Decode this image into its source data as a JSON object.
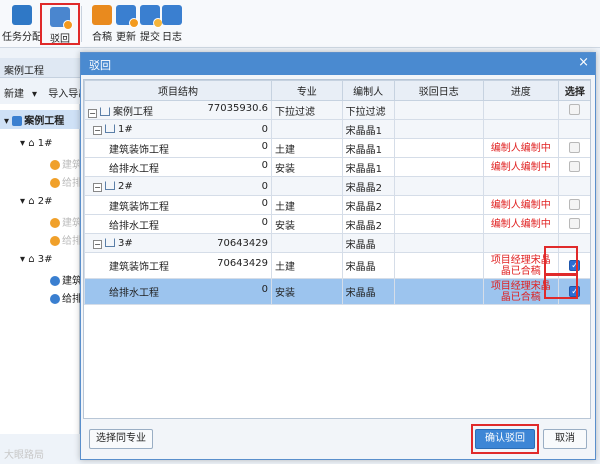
{
  "toolbar": {
    "buttons": [
      {
        "label": "任务分配",
        "icon": "assign-icon"
      },
      {
        "label": "驳回",
        "icon": "reject-icon"
      },
      {
        "label": "合稿",
        "icon": "merge-icon"
      },
      {
        "label": "更新",
        "icon": "update-icon"
      },
      {
        "label": "提交",
        "icon": "submit-icon"
      },
      {
        "label": "日志",
        "icon": "log-icon"
      }
    ]
  },
  "left": {
    "header": "案例工程",
    "tool_new": "新建",
    "tool_io": "导入导出",
    "tree": [
      {
        "label": "案例工程"
      },
      {
        "label": "1#"
      },
      {
        "label": "建筑"
      },
      {
        "label": "给排"
      },
      {
        "label": "2#"
      },
      {
        "label": "建筑"
      },
      {
        "label": "给排"
      },
      {
        "label": "3#"
      },
      {
        "label": "建筑"
      },
      {
        "label": "给排"
      }
    ]
  },
  "dialog": {
    "title": "驳回",
    "columns": [
      "项目结构",
      "专业",
      "编制人",
      "驳回日志",
      "进度",
      "选择"
    ],
    "rows": [
      {
        "name": "案例工程",
        "amount": "77035930.6",
        "major": "下拉过滤",
        "editor": "下拉过滤",
        "log": "",
        "progress": "",
        "level": 0
      },
      {
        "name": "1#",
        "amount": "0",
        "major": "",
        "editor": "宋晶晶1",
        "log": "",
        "progress": "",
        "level": 1
      },
      {
        "name": "建筑装饰工程",
        "amount": "0",
        "major": "土建",
        "editor": "宋晶晶1",
        "log": "",
        "progress": "编制人编制中",
        "level": 2
      },
      {
        "name": "给排水工程",
        "amount": "0",
        "major": "安装",
        "editor": "宋晶晶1",
        "log": "",
        "progress": "编制人编制中",
        "level": 2
      },
      {
        "name": "2#",
        "amount": "0",
        "major": "",
        "editor": "宋晶晶2",
        "log": "",
        "progress": "",
        "level": 1
      },
      {
        "name": "建筑装饰工程",
        "amount": "0",
        "major": "土建",
        "editor": "宋晶晶2",
        "log": "",
        "progress": "编制人编制中",
        "level": 2
      },
      {
        "name": "给排水工程",
        "amount": "0",
        "major": "安装",
        "editor": "宋晶晶2",
        "log": "",
        "progress": "编制人编制中",
        "level": 2
      },
      {
        "name": "3#",
        "amount": "70643429",
        "major": "",
        "editor": "宋晶晶",
        "log": "",
        "progress": "",
        "level": 1
      },
      {
        "name": "建筑装饰工程",
        "amount": "70643429",
        "major": "土建",
        "editor": "宋晶晶",
        "log": "",
        "progress": "项目经理宋晶晶已合稿",
        "level": 2
      },
      {
        "name": "给排水工程",
        "amount": "0",
        "major": "安装",
        "editor": "宋晶晶",
        "log": "",
        "progress": "项目经理宋晶晶已合稿",
        "level": 2
      }
    ],
    "btn_select_same": "选择同专业",
    "btn_confirm": "确认驳回",
    "btn_cancel": "取消"
  },
  "watermark": "大眼路局",
  "colors": {
    "accent": "#4a8ad0",
    "highlight": "#e02a2a",
    "progress_text": "#e02020"
  }
}
